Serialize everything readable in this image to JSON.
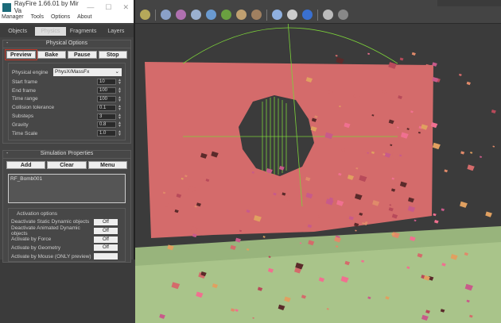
{
  "window": {
    "title": "RayFire 1.66.01  by Mir Va",
    "minimize": "—",
    "maximize": "☐",
    "close": "✕"
  },
  "menu": [
    "Manager",
    "Tools",
    "Options",
    "About"
  ],
  "tabs": [
    {
      "label": "Objects"
    },
    {
      "label": "Physics",
      "active": true
    },
    {
      "label": "Fragments"
    },
    {
      "label": "Layers"
    }
  ],
  "physical_options": {
    "header": "Physical Options",
    "toggle": "-",
    "buttons": [
      "Preview",
      "Bake",
      "Pause",
      "Stop"
    ],
    "engine_label": "Physical engine",
    "engine_value": "PhysX/MassFx",
    "fields": [
      {
        "label": "Start frame",
        "value": "10"
      },
      {
        "label": "End frame",
        "value": "100"
      },
      {
        "label": "Time range",
        "value": "100"
      },
      {
        "label": "Collision tolerance",
        "value": "0.1"
      },
      {
        "label": "Substeps",
        "value": "3"
      },
      {
        "label": "Gravity",
        "value": "0.8"
      },
      {
        "label": "Time Scale",
        "value": "1.0"
      }
    ]
  },
  "simulation_properties": {
    "header": "Simulation Properties",
    "toggle": "-",
    "buttons": [
      "Add",
      "Clear",
      "Menu"
    ],
    "list": [
      "RF_Bomb001"
    ],
    "activation": {
      "title": "Activation options",
      "rows": [
        {
          "label": "Deactivate Static Dynamic objects",
          "value": "Off"
        },
        {
          "label": "Deactivate Animated Dynamic objects",
          "value": "Off"
        },
        {
          "label": "Activate by Force",
          "value": "Off"
        },
        {
          "label": "Activate by Geometry",
          "value": "Off"
        },
        {
          "label": "Activate by Mouse (ONLY preview)",
          "value": ""
        }
      ]
    }
  },
  "colors": {
    "wall": "#d46b6b",
    "floor": "#a9c48a",
    "viewport": "#3b3b3b",
    "selection": "#7cd23a"
  },
  "toolbar_icons": [
    "light-icon",
    "grid-icon",
    "material-icon",
    "helper-icon",
    "sphere-icon",
    "leaf-icon",
    "animal-icon",
    "rock-icon",
    "globe-icon",
    "copy-icon",
    "render-icon",
    "file-icon",
    "help-icon"
  ]
}
